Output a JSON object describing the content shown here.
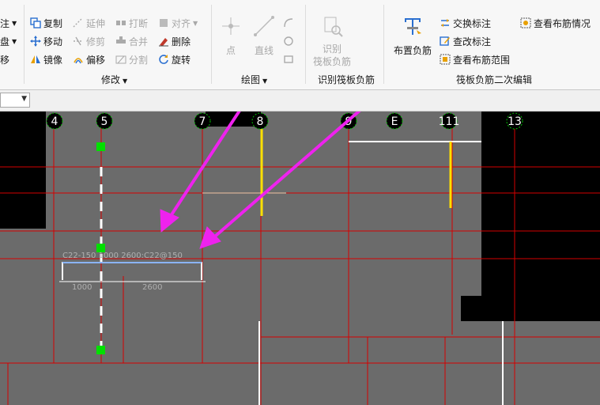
{
  "ribbon": {
    "left_clip": {
      "item1": "注",
      "item2": "盘",
      "item3": "移"
    },
    "modify": {
      "copy": "复制",
      "extend": "延伸",
      "break": "打断",
      "align": "对齐",
      "move": "移动",
      "trim": "修剪",
      "merge": "合并",
      "delete": "删除",
      "mirror": "镜像",
      "offset": "偏移",
      "split": "分割",
      "rotate": "旋转",
      "group_label": "修改"
    },
    "draw": {
      "point": "点",
      "line": "直线",
      "group_label": "绘图"
    },
    "identify": {
      "button": "识别\n筏板负筋",
      "group_label": "识别筏板负筋"
    },
    "edit": {
      "place_rebar": "布置负筋",
      "swap_label": "交换标注",
      "check_label": "查改标注",
      "view_range": "查看布筋范围",
      "view_layout": "查看布筋情况",
      "group_label": "筏板负筋二次编辑"
    }
  },
  "canvas": {
    "axis_labels": [
      "4",
      "5",
      "7",
      "8",
      "9",
      "E",
      "111",
      "13"
    ],
    "rebar_annotation": "C22-150 1000 2600:C22@150",
    "dim_left": "1000",
    "dim_right": "2600"
  },
  "colors": {
    "grid": "#d40000",
    "rebar_yellow": "#ffe000",
    "arrow_magenta": "#ee22ee",
    "node_green": "#00e000",
    "canvas_bg": "#6b6b6b"
  }
}
